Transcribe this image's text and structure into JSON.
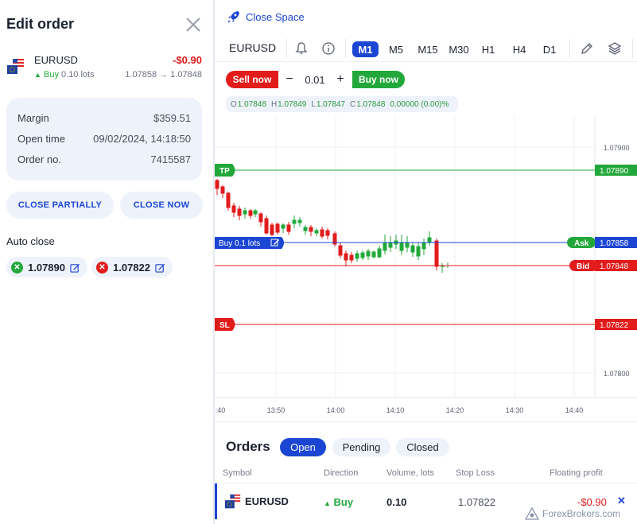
{
  "edit_order": {
    "title": "Edit order",
    "symbol": "EURUSD",
    "pl": "-$0.90",
    "direction": "Buy",
    "lots": "0.10 lots",
    "prices": "1.07858 → 1.07848",
    "margin_label": "Margin",
    "margin_value": "$359.51",
    "open_time_label": "Open time",
    "open_time_value": "09/02/2024, 14:18:50",
    "order_no_label": "Order no.",
    "order_no_value": "7415587",
    "close_partially": "CLOSE PARTIALLY",
    "close_now": "CLOSE NOW",
    "auto_close_label": "Auto close",
    "take_profit": "1.07890",
    "stop_loss": "1.07822"
  },
  "toolbar": {
    "close_space": "Close Space",
    "symbol": "EURUSD",
    "timeframes": [
      "M1",
      "M5",
      "M15",
      "M30",
      "H1",
      "H4",
      "D1"
    ],
    "active_timeframe": "M1",
    "icons": [
      "bell-icon",
      "info-icon",
      "pencil-icon",
      "layers-icon"
    ]
  },
  "trade": {
    "sell_label": "Sell now",
    "minus": "−",
    "quantity": "0.01",
    "plus": "+",
    "buy_label": "Buy now"
  },
  "ohlc": {
    "o_key": "O",
    "o": "1.07848",
    "h_key": "H",
    "h": "1.07849",
    "l_key": "L",
    "l": "1.07847",
    "c_key": "C",
    "c": "1.07848",
    "change": "0.00000 (0.00)%"
  },
  "chart": {
    "price_axis": [
      "1.07900",
      "1.07800"
    ],
    "time_axis": [
      ":40",
      "13:50",
      "14:00",
      "14:10",
      "14:20",
      "14:30",
      "14:40"
    ],
    "lines": {
      "tp": {
        "label": "TP",
        "price": "1.07890",
        "color": "#22a83a"
      },
      "ask": {
        "label": "Ask",
        "price": "1.07858",
        "color": "#1b46d3"
      },
      "bid": {
        "label": "Bid",
        "price": "1.07848",
        "color": "#e21b1b"
      },
      "sl": {
        "label": "SL",
        "price": "1.07822",
        "color": "#e21b1b"
      }
    },
    "position_label": "Buy 0.1 lots"
  },
  "orders": {
    "title": "Orders",
    "tabs": [
      "Open",
      "Pending",
      "Closed"
    ],
    "active_tab": "Open",
    "columns": [
      "Symbol",
      "Direction",
      "Volume, lots",
      "Stop Loss",
      "Floating profit"
    ],
    "rows": [
      {
        "symbol": "EURUSD",
        "direction": "Buy",
        "volume": "0.10",
        "stop_loss": "1.07822",
        "profit": "-$0.90"
      }
    ]
  },
  "watermark": "ForexBrokers.com",
  "colors": {
    "accent": "#1b46d3",
    "buy": "#22a83a",
    "sell": "#e21b1b",
    "card": "#eef2fa"
  }
}
